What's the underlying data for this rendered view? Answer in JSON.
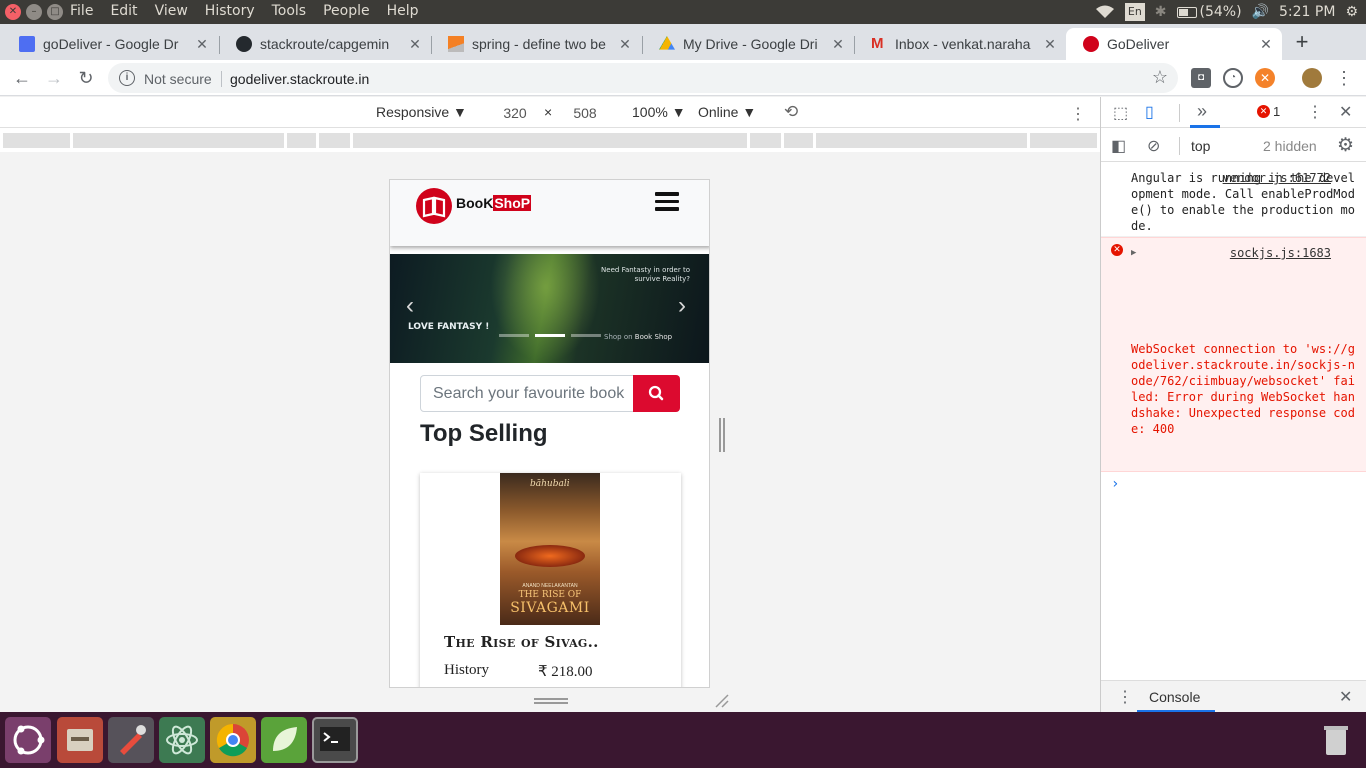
{
  "system": {
    "menu": [
      "File",
      "Edit",
      "View",
      "History",
      "Tools",
      "People",
      "Help"
    ],
    "keyboard": "En",
    "battery": "(54%)",
    "time": "5:21 PM"
  },
  "tabs": [
    {
      "title": "goDeliver - Google Dr",
      "icon": "google-docs-icon"
    },
    {
      "title": "stackroute/capgemin",
      "icon": "github-icon"
    },
    {
      "title": "spring - define two be",
      "icon": "stackoverflow-icon"
    },
    {
      "title": "My Drive - Google Dri",
      "icon": "google-drive-icon"
    },
    {
      "title": "Inbox - venkat.naraha",
      "icon": "gmail-icon"
    },
    {
      "title": "GoDeliver",
      "icon": "godeliver-icon",
      "active": true
    }
  ],
  "address": {
    "security": "Not secure",
    "url": "godeliver.stackroute.in"
  },
  "device_toolbar": {
    "device": "Responsive",
    "width": "320",
    "times": "×",
    "height": "508",
    "zoom": "100%",
    "network": "Online"
  },
  "page": {
    "logo_book": "BooK",
    "logo_shop": "ShoP",
    "banner_quote": "Need Fantasty in order to survive Reality?",
    "banner_tag": "LOVE FANTASY !",
    "banner_shop_on": "Shop on",
    "banner_shop_name": "Book Shop",
    "search_placeholder": "Search your favourite book",
    "section_title": "Top Selling",
    "book": {
      "cover_series": "bāhubali",
      "cover_author": "ANAND NEELAKANTAN",
      "cover_title_1": "THE RISE OF",
      "cover_title_2": "SIVAGAMI",
      "title": "The Rise of Sivag..",
      "genre": "History",
      "price": "₹ 218.00"
    }
  },
  "devtools": {
    "error_count": "1",
    "context": "top",
    "hidden": "2 hidden",
    "messages": [
      {
        "source": "vendor.js:61772",
        "text": "Angular is running in the development mode. Call enableProdMode() to enable the production mode.",
        "level": "info"
      },
      {
        "source": "sockjs.js:1683",
        "text": "WebSocket connection to 'ws://godeliver.stackroute.in/sockjs-node/762/ciimbuay/websocket' failed: Error during WebSocket handshake: Unexpected response code: 400",
        "level": "error"
      }
    ],
    "prompt": "›",
    "drawer_tab": "Console"
  },
  "colors": {
    "brand": "#d0021b",
    "search_button": "#dc0a2f",
    "launcher_bg": "#3a1730",
    "error_text": "#e51400"
  }
}
